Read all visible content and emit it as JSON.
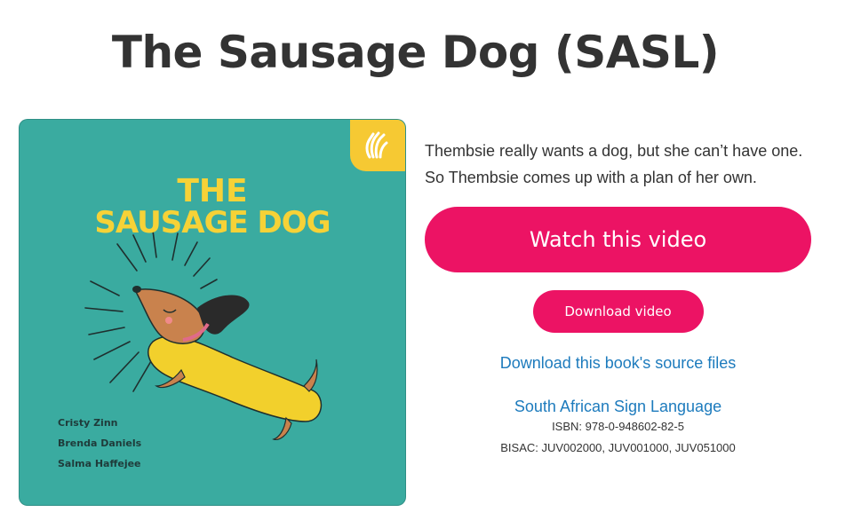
{
  "page": {
    "title": "The Sausage Dog (SASL)"
  },
  "cover": {
    "title_line1": "THE",
    "title_line2": "SAUSAGE DOG",
    "authors": [
      "Cristy Zinn",
      "Brenda Daniels",
      "Salma Haffejee"
    ],
    "badge_icon": "sign-language-hands-icon",
    "background_color": "#3aaba0",
    "title_color": "#f6d237",
    "badge_color": "#f6c933"
  },
  "info": {
    "description_line1": "Thembsie really wants a dog, but she can’t have one.",
    "description_line2": "So Thembsie comes up with a plan of her own.",
    "watch_label": "Watch this video",
    "download_video_label": "Download video",
    "source_files_label": "Download this book's source files",
    "language_label": "South African Sign Language",
    "isbn": "ISBN: 978-0-948602-82-5",
    "bisac": "BISAC: JUV002000, JUV001000, JUV051000",
    "accent_color": "#ec1364",
    "link_color": "#1d7bbd"
  }
}
